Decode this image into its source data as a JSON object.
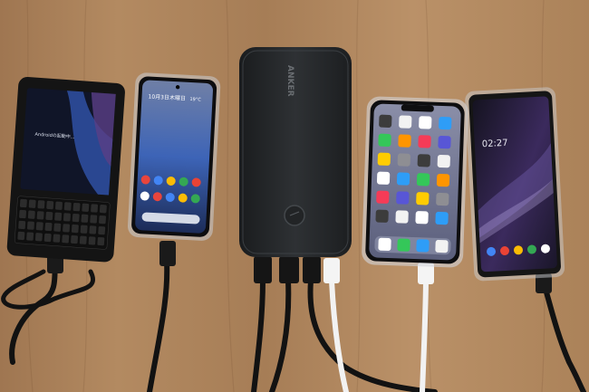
{
  "photo": {
    "description_items": [
      "keyboard-phone",
      "android-phone",
      "power-bank",
      "iphone",
      "sharp-phone"
    ]
  },
  "power_bank": {
    "brand": "ANKER"
  },
  "android_phone": {
    "date_text": "10月3日木曜日",
    "temp_text": "19°C"
  },
  "keyboard_phone": {
    "screen_text": "Androidの起動中..."
  },
  "sharp_phone": {
    "clock_text": "02:27"
  },
  "colors": {
    "table": "#b08860",
    "cable_black": "#121212",
    "cable_white": "#f2f2f2"
  }
}
